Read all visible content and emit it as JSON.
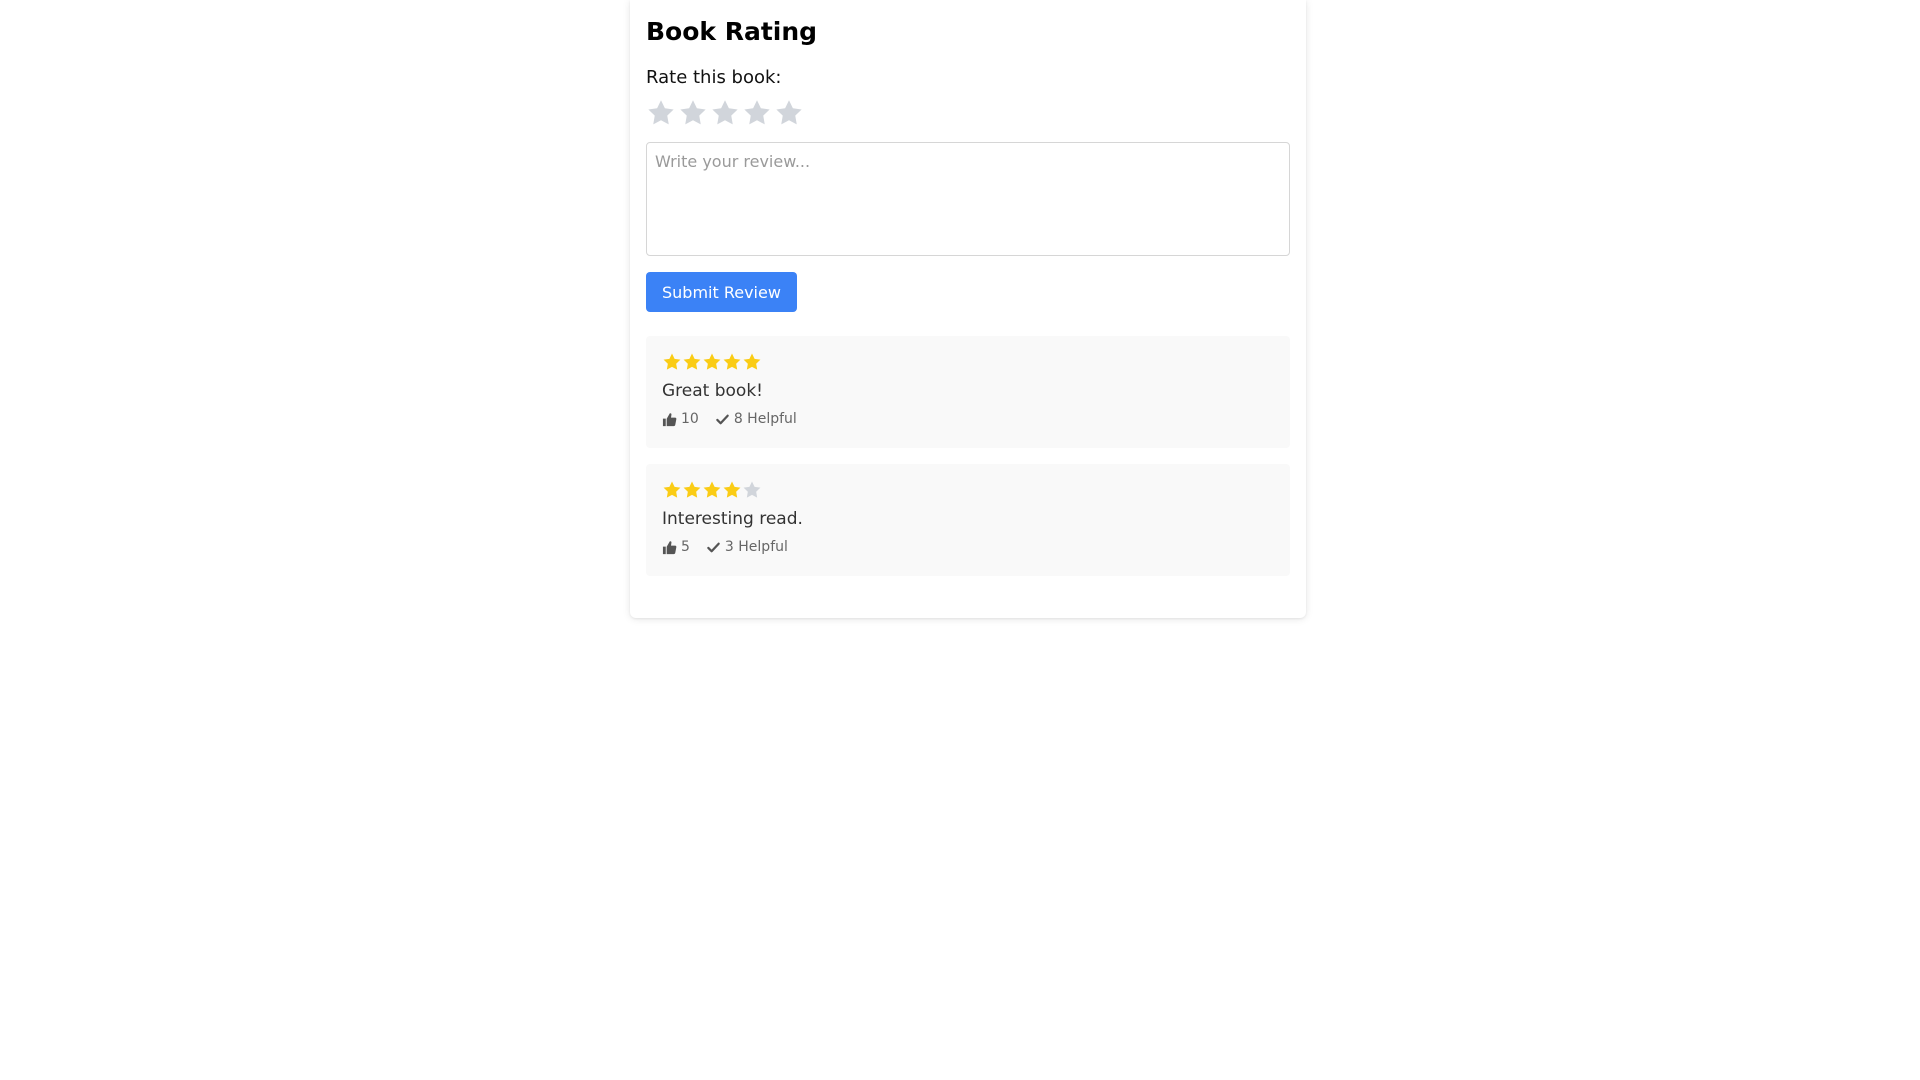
{
  "title": "Book Rating",
  "rate": {
    "label": "Rate this book:",
    "max_stars": 5,
    "selected": 0,
    "star_color_empty": "#d1d5db",
    "star_color_filled": "#facc15",
    "icon": "star-icon"
  },
  "review_input": {
    "placeholder": "Write your review...",
    "value": ""
  },
  "submit": {
    "label": "Submit Review",
    "color": "#3b82f6"
  },
  "reviews": [
    {
      "rating": 5,
      "text": "Great book!",
      "likes": "10",
      "helpful": "8 Helpful"
    },
    {
      "rating": 4,
      "text": "Interesting read.",
      "likes": "5",
      "helpful": "3 Helpful"
    }
  ]
}
